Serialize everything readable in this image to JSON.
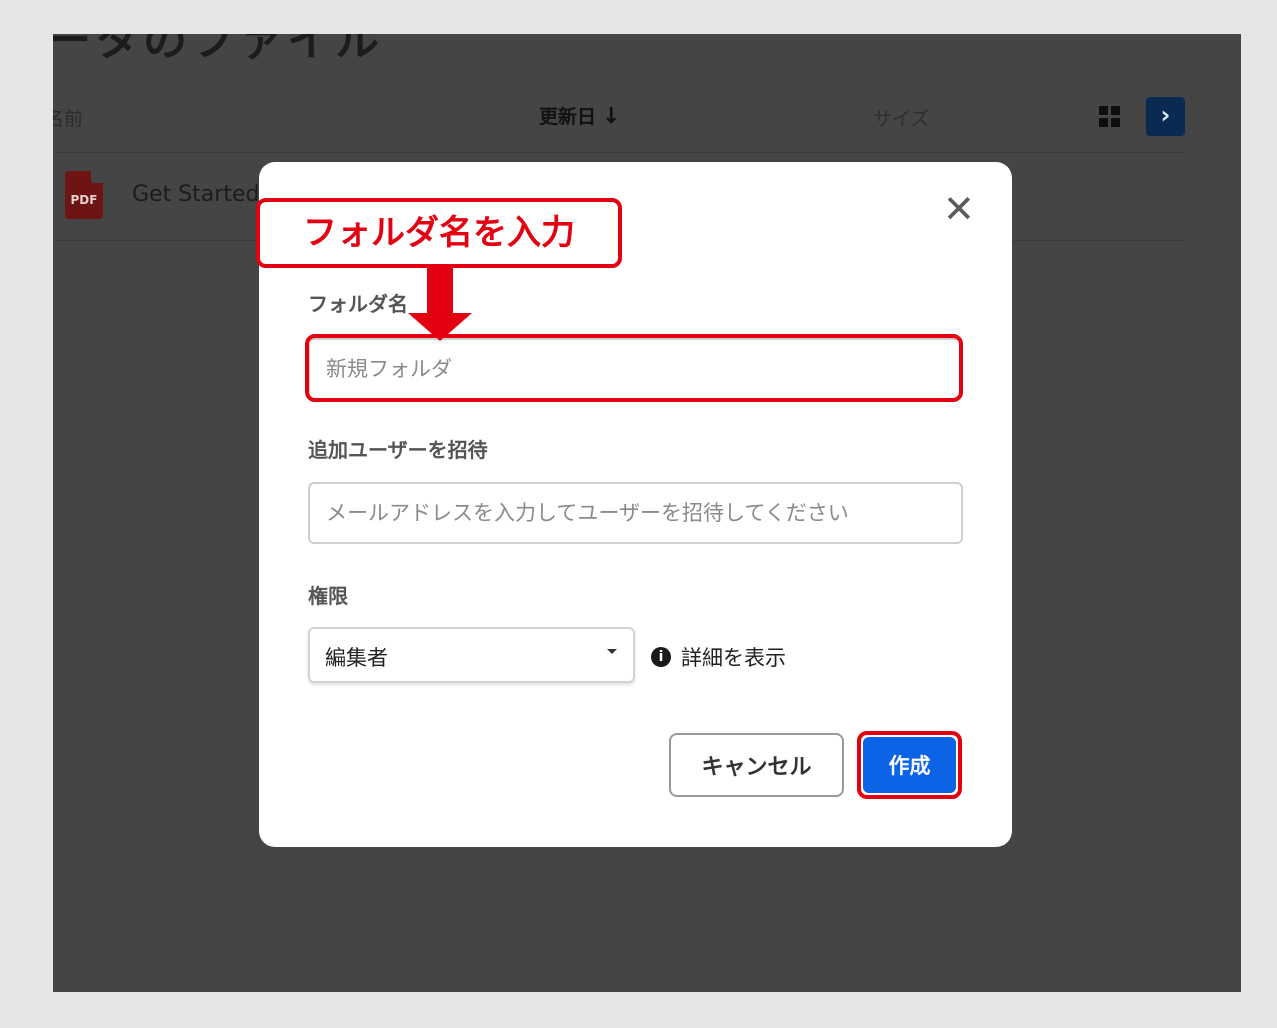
{
  "background": {
    "page_title_fragment": "ータのファイル",
    "columns": {
      "name": "名前",
      "updated": "更新日",
      "updated_sort_arrow": "↓",
      "size": "サイズ"
    },
    "files": [
      {
        "icon_label": "PDF",
        "name": "Get Started"
      }
    ]
  },
  "dialog": {
    "folder_name_label": "フォルダ名",
    "folder_name_placeholder": "新規フォルダ",
    "invite_label": "追加ユーザーを招待",
    "invite_placeholder": "メールアドレスを入力してユーザーを招待してください",
    "permission_label": "権限",
    "permission_value": "編集者",
    "details_label": "詳細を表示",
    "cancel_label": "キャンセル",
    "create_label": "作成"
  },
  "annotation": {
    "callout_text": "フォルダ名を入力"
  },
  "colors": {
    "highlight": "#e30010",
    "primary_button": "#0b63e6",
    "overlay": "#454545"
  },
  "icons": [
    "sort-down-arrow-icon",
    "grid-view-icon",
    "chevron-right-icon",
    "pdf-file-icon",
    "close-icon",
    "dropdown-caret-icon",
    "info-icon"
  ]
}
